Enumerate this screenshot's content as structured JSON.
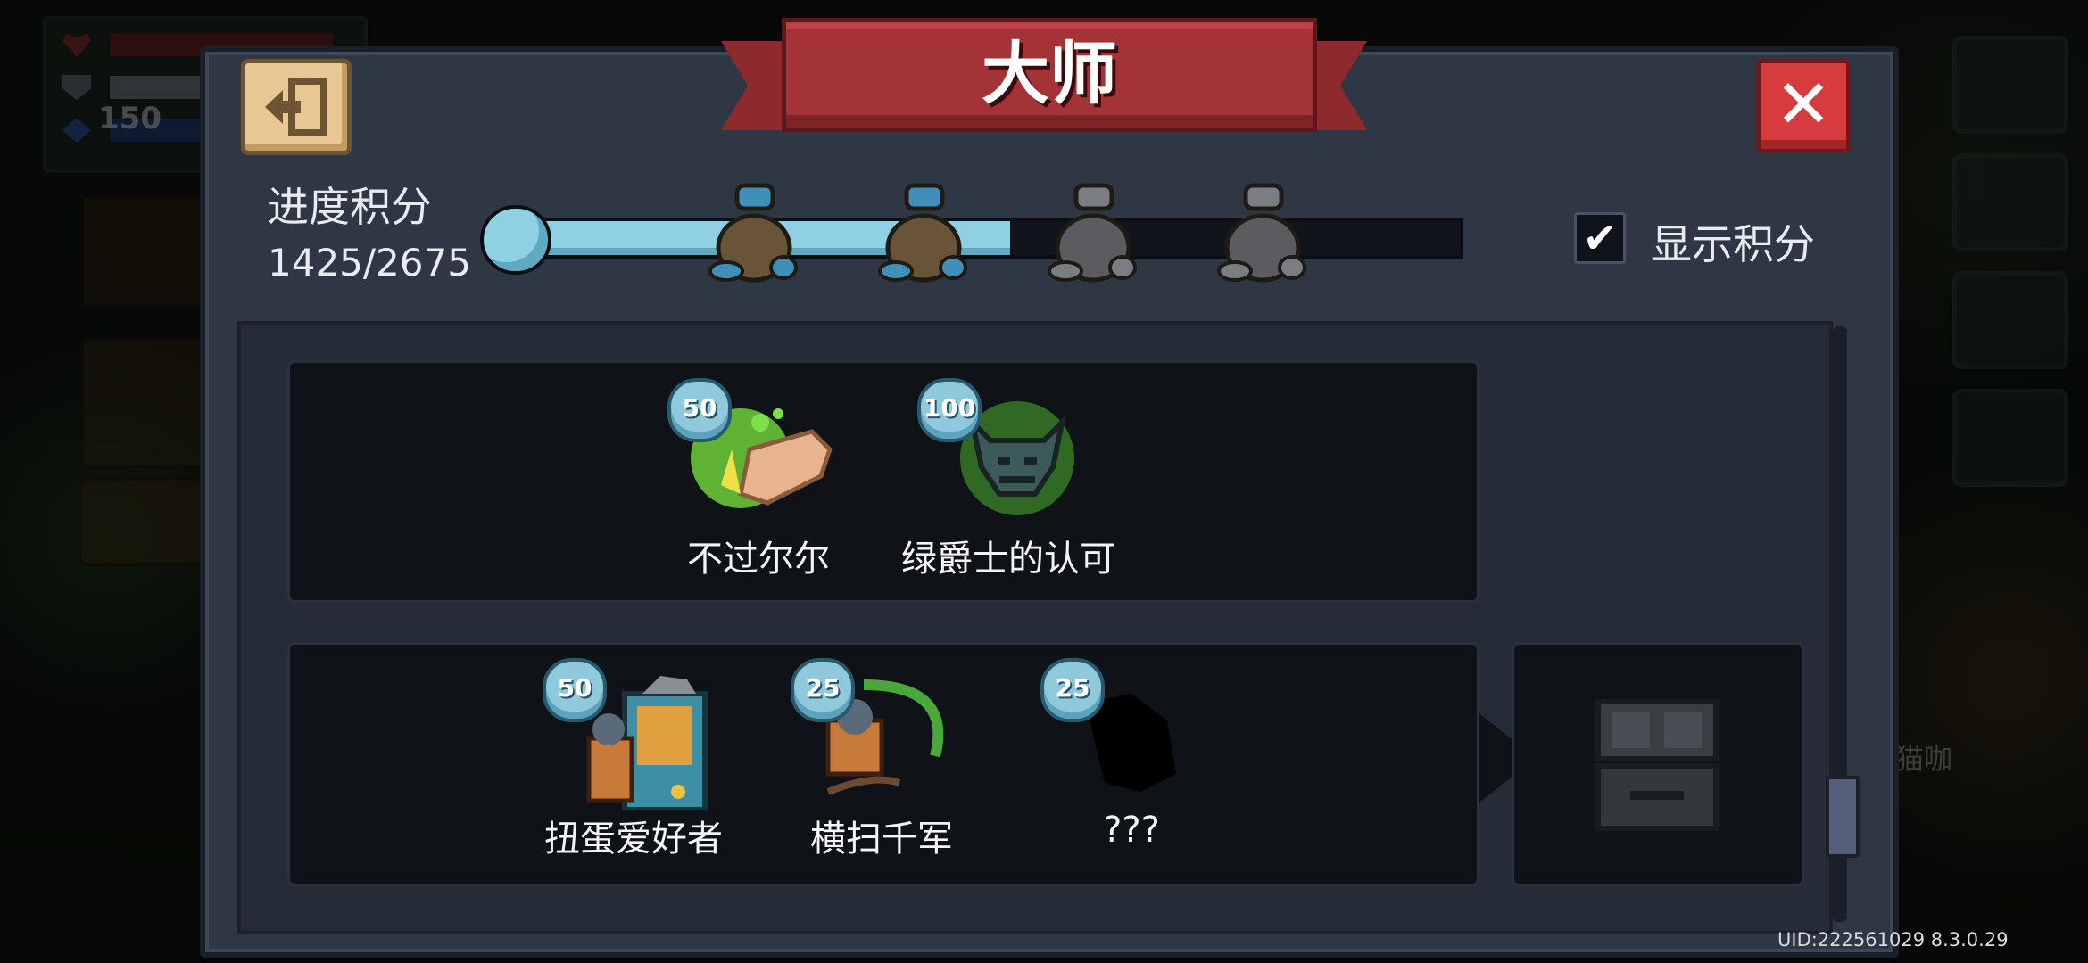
{
  "window": {
    "title": "大师"
  },
  "progress": {
    "label": "进度积分",
    "value": "1425/2675",
    "current": 1425,
    "max": 2675,
    "rewards_claimed": 2,
    "rewards_total": 4
  },
  "toggle": {
    "label": "显示积分",
    "checked": true
  },
  "rows": [
    {
      "items": [
        {
          "name": "不过尔尔",
          "points": "50",
          "icon": "slap-hand-icon",
          "locked": false
        },
        {
          "name": "绿爵士的认可",
          "points": "100",
          "icon": "green-knight-helmet-icon",
          "locked": false
        }
      ]
    },
    {
      "items": [
        {
          "name": "扭蛋爱好者",
          "points": "50",
          "icon": "gacha-machine-icon",
          "locked": false
        },
        {
          "name": "横扫千军",
          "points": "25",
          "icon": "sweeping-warrior-icon",
          "locked": false
        },
        {
          "name": "???",
          "points": "25",
          "icon": "locked-silhouette-icon",
          "locked": true
        }
      ],
      "reward": {
        "icon": "treasure-chest-icon",
        "state": "locked"
      }
    }
  ],
  "hud": {
    "resource_value": "150",
    "side_label": "猫咖"
  },
  "footer": {
    "uid": "UID:222561029 8.3.0.29"
  },
  "colors": {
    "banner": "#a33336",
    "progress_fill": "#8fd0e2",
    "close": "#d63b3f",
    "panel": "#2f3745"
  }
}
